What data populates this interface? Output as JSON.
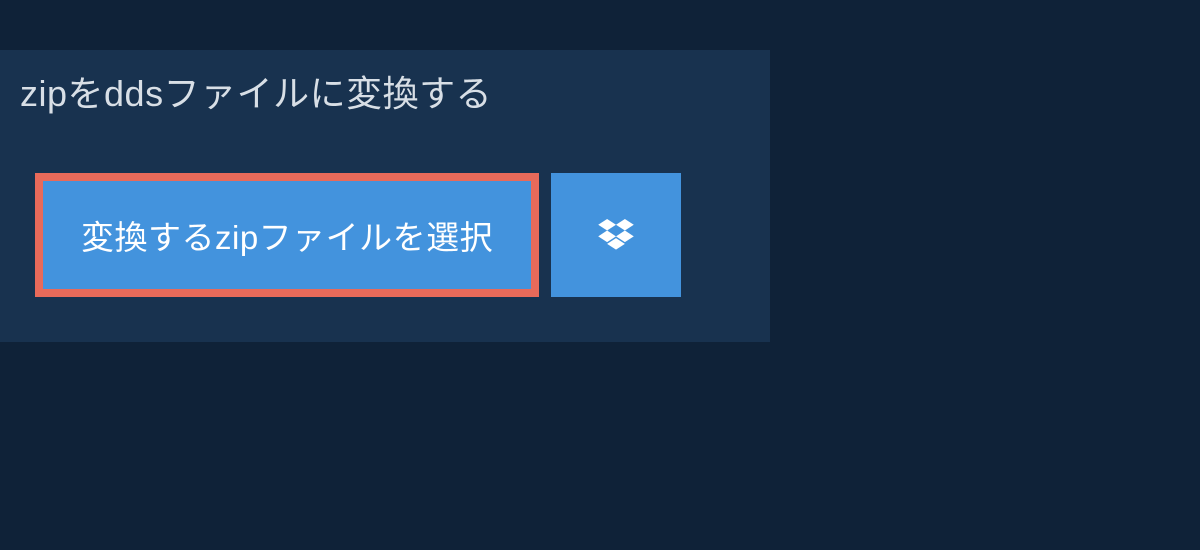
{
  "title": "zipをddsファイルに変換する",
  "buttons": {
    "select_file_label": "変換するzipファイルを選択"
  },
  "icons": {
    "dropbox": "dropbox-icon"
  },
  "colors": {
    "background": "#0f2238",
    "panel": "#18324f",
    "button_primary": "#4393dd",
    "button_border": "#e86a5a",
    "text_light": "#d8dfe6",
    "text_white": "#ffffff"
  }
}
